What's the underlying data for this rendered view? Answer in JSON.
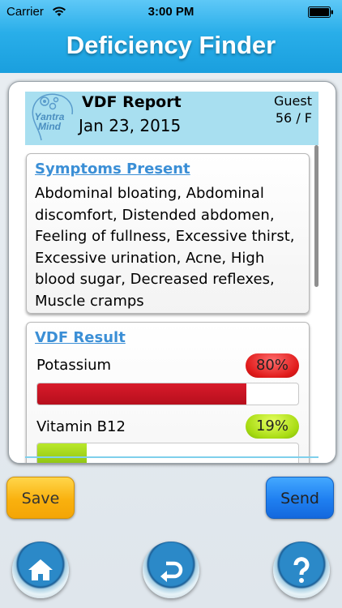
{
  "status_bar": {
    "carrier": "Carrier",
    "time": "3:00 PM"
  },
  "header": {
    "title": "Deficiency Finder"
  },
  "report": {
    "logo_text_line1": "Yantra",
    "logo_text_line2": "Mind",
    "title": "VDF Report",
    "date": "Jan 23, 2015",
    "user_label": "Guest",
    "user_info": "56 / F"
  },
  "symptoms": {
    "title": "Symptoms Present",
    "text": "Abdominal bloating, Abdominal discomfort, Distended abdomen, Feeling of fullness, Excessive thirst, Excessive urination, Acne, High blood sugar, Decreased reflexes, Muscle cramps"
  },
  "result": {
    "title": "VDF Result",
    "items": [
      {
        "name": "Potassium",
        "percent_label": "80%",
        "fraction": 0.8,
        "color": "#c9161f"
      },
      {
        "name": "Vitamin B12",
        "percent_label": "19%",
        "fraction": 0.19,
        "color": "#a6d81a"
      }
    ]
  },
  "actions": {
    "save_label": "Save",
    "send_label": "Send"
  },
  "nav": {
    "home_icon": "home-icon",
    "back_icon": "undo-icon",
    "help_icon": "help-icon"
  }
}
